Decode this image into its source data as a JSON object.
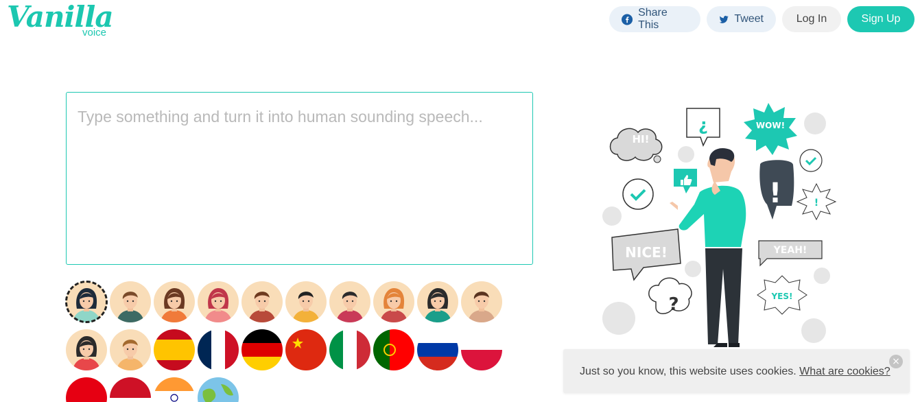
{
  "brand": {
    "name": "Vanilla",
    "sub": "voice"
  },
  "nav": {
    "share_label": "Share This",
    "tweet_label": "Tweet",
    "login_label": "Log In",
    "signup_label": "Sign Up"
  },
  "editor": {
    "placeholder": "Type something and turn it into human sounding speech..."
  },
  "voices": [
    {
      "type": "avatar",
      "icon": "woman-avatar-icon",
      "hair": "#1e2b3a",
      "shirt": "#8fd6c8",
      "selected": true
    },
    {
      "type": "avatar",
      "icon": "man-avatar-icon",
      "hair": "#7a4b2a",
      "shirt": "#3d6a64"
    },
    {
      "type": "avatar",
      "icon": "woman-avatar-icon",
      "hair": "#6b3a23",
      "shirt": "#f07a3a"
    },
    {
      "type": "avatar",
      "icon": "woman-avatar-icon",
      "hair": "#c0364a",
      "shirt": "#f18b8b"
    },
    {
      "type": "avatar",
      "icon": "man-avatar-icon",
      "hair": "#6e3a1f",
      "shirt": "#b84a3a"
    },
    {
      "type": "avatar",
      "icon": "man-avatar-icon",
      "hair": "#222222",
      "shirt": "#f3b13a"
    },
    {
      "type": "avatar",
      "icon": "man-avatar-icon",
      "hair": "#2b2b2b",
      "shirt": "#c93a58"
    },
    {
      "type": "avatar",
      "icon": "woman-avatar-icon",
      "hair": "#e4843a",
      "shirt": "#c94a4a"
    },
    {
      "type": "avatar",
      "icon": "woman-avatar-icon",
      "hair": "#2b2b2b",
      "shirt": "#1a9e8a"
    },
    {
      "type": "avatar",
      "icon": "man-avatar-icon",
      "hair": "#5a3420",
      "shirt": "#d9a88a"
    },
    {
      "type": "avatar",
      "icon": "woman-avatar-icon",
      "hair": "#2b2b2b",
      "shirt": "#e8474a"
    },
    {
      "type": "avatar",
      "icon": "man-avatar-icon",
      "hair": "#a46a2e",
      "shirt": "#f5b56a"
    },
    {
      "type": "flag",
      "icon": "spain-flag-icon",
      "stripes": [
        "#c60b1e",
        "#ffc400",
        "#c60b1e"
      ],
      "weights": [
        1,
        2,
        1
      ],
      "dir": "h"
    },
    {
      "type": "flag",
      "icon": "france-flag-icon",
      "stripes": [
        "#002654",
        "#ffffff",
        "#ce1126"
      ],
      "weights": [
        1,
        1,
        1
      ],
      "dir": "v"
    },
    {
      "type": "flag",
      "icon": "germany-flag-icon",
      "stripes": [
        "#000000",
        "#dd0000",
        "#ffce00"
      ],
      "weights": [
        1,
        1,
        1
      ],
      "dir": "h"
    },
    {
      "type": "flag",
      "icon": "china-flag-icon",
      "stripes": [
        "#de2910"
      ],
      "weights": [
        1
      ],
      "dir": "h",
      "star": "#ffde00"
    },
    {
      "type": "flag",
      "icon": "italy-flag-icon",
      "stripes": [
        "#009246",
        "#ffffff",
        "#ce2b37"
      ],
      "weights": [
        1,
        1,
        1
      ],
      "dir": "v"
    },
    {
      "type": "flag",
      "icon": "portugal-flag-icon",
      "stripes": [
        "#006600",
        "#ff0000"
      ],
      "weights": [
        2,
        3
      ],
      "dir": "v",
      "emblem": "#ffcc00"
    },
    {
      "type": "flag",
      "icon": "russia-flag-icon",
      "stripes": [
        "#ffffff",
        "#0039a6",
        "#d52b1e"
      ],
      "weights": [
        1,
        1,
        1
      ],
      "dir": "h"
    },
    {
      "type": "flag",
      "icon": "poland-flag-icon",
      "stripes": [
        "#ffffff",
        "#dc143c"
      ],
      "weights": [
        1,
        1
      ],
      "dir": "h"
    },
    {
      "type": "flag",
      "icon": "japan-flag-icon",
      "stripes": [
        "#e60012"
      ],
      "weights": [
        1
      ],
      "dir": "h"
    },
    {
      "type": "flag",
      "icon": "indonesia-flag-icon",
      "stripes": [
        "#ce1126",
        "#ffffff"
      ],
      "weights": [
        1,
        1
      ],
      "dir": "h"
    },
    {
      "type": "flag",
      "icon": "india-flag-icon",
      "stripes": [
        "#ff9933",
        "#ffffff",
        "#138808"
      ],
      "weights": [
        1,
        1,
        1
      ],
      "dir": "h",
      "wheel": "#000080"
    },
    {
      "type": "flag",
      "icon": "globe-icon",
      "stripes": [
        "#7cc4e8"
      ],
      "weights": [
        1
      ],
      "dir": "h",
      "land": "#7bbf3e"
    }
  ],
  "illustration": {
    "icon": "thinking-man-illustration",
    "bubbles": [
      "HI!",
      "¿",
      "WOW!",
      "!",
      "NICE!",
      "YEAH!",
      "?",
      "YES!"
    ]
  },
  "cookie": {
    "text": "Just so you know, this website uses cookies.",
    "link": "What are cookies?",
    "close": "×"
  },
  "colors": {
    "accent": "#1dc8b2",
    "share_bg": "#eaf1f8"
  }
}
